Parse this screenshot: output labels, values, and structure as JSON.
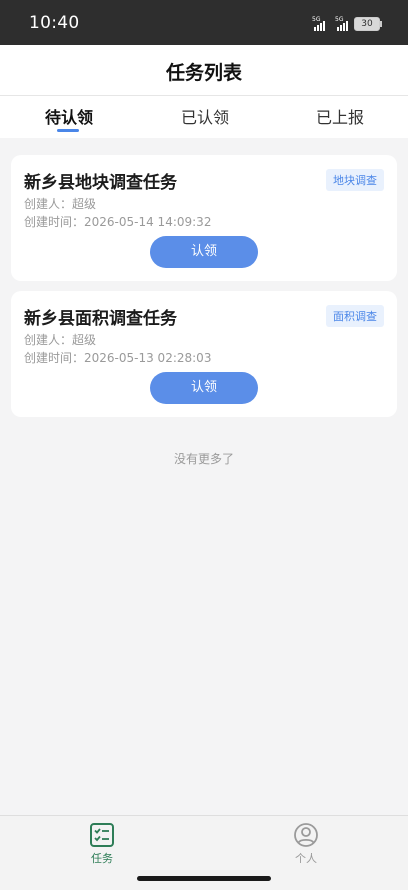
{
  "status_bar": {
    "time": "10:40",
    "signal1_tag": "5G",
    "signal2_tag": "5G",
    "battery": "30"
  },
  "header": {
    "title": "任务列表"
  },
  "tabs": [
    {
      "label": "待认领",
      "active": true
    },
    {
      "label": "已认领",
      "active": false
    },
    {
      "label": "已上报",
      "active": false
    }
  ],
  "tasks": [
    {
      "title": "新乡县地块调查任务",
      "tag": "地块调查",
      "creator": "创建人：超级",
      "created_time": "创建时间：2026-05-14 14:09:32",
      "action": "认领"
    },
    {
      "title": "新乡县面积调查任务",
      "tag": "面积调查",
      "creator": "创建人：超级",
      "created_time": "创建时间：2026-05-13 02:28:03",
      "action": "认领"
    }
  ],
  "list_end_text": "没有更多了",
  "bottom_nav": [
    {
      "label": "任务",
      "icon": "task-list-icon",
      "active": true
    },
    {
      "label": "个人",
      "icon": "person-icon",
      "active": false
    }
  ],
  "colors": {
    "accent": "#4a86e8",
    "button": "#5b8ee8",
    "nav_active": "#2e7d57",
    "nav_inactive": "#9a9a9a"
  }
}
